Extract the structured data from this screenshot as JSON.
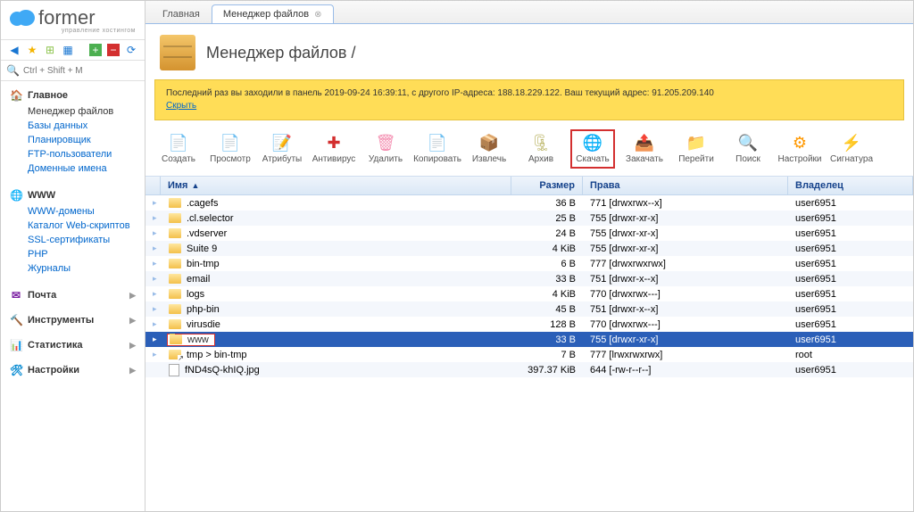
{
  "brand": {
    "name": "former",
    "tagline": "управление хостингом"
  },
  "search": {
    "placeholder": "Ctrl + Shift + M"
  },
  "sidebar": {
    "sections": [
      {
        "title": "Главное",
        "icon": "🏠",
        "icon_color": "#f4b400",
        "expanded": true,
        "items": [
          "Менеджер файлов",
          "Базы данных",
          "Планировщик",
          "FTP-пользователи",
          "Доменные имена"
        ],
        "current": 0
      },
      {
        "title": "WWW",
        "icon": "🌐",
        "icon_color": "#1976d2",
        "expanded": true,
        "items": [
          "WWW-домены",
          "Каталог Web-скриптов",
          "SSL-сертификаты",
          "PHP",
          "Журналы"
        ],
        "current": -1
      },
      {
        "title": "Почта",
        "icon": "✉",
        "icon_color": "#7b1fa2",
        "expanded": false
      },
      {
        "title": "Инструменты",
        "icon": "🔨",
        "icon_color": "#d32f2f",
        "expanded": false
      },
      {
        "title": "Статистика",
        "icon": "📊",
        "icon_color": "#0288d1",
        "expanded": false
      },
      {
        "title": "Настройки",
        "icon": "🛠",
        "icon_color": "#0288d1",
        "expanded": false
      }
    ]
  },
  "tabs": [
    {
      "label": "Главная",
      "active": false,
      "closable": false
    },
    {
      "label": "Менеджер файлов",
      "active": true,
      "closable": true
    }
  ],
  "page": {
    "title": "Менеджер файлов /"
  },
  "notice": {
    "text_prefix": "Последний раз вы заходили в панель 2019-09-24 16:39:11, с другого IP-адреса: 188.18.229.122. Ваш текущий адрес: 91.205.209.140",
    "hide": "Скрыть"
  },
  "toolbar": [
    {
      "id": "create",
      "label": "Создать",
      "icon": "📄",
      "color": "#4caf50"
    },
    {
      "id": "view",
      "label": "Просмотр",
      "icon": "📄",
      "color": "#90caf9"
    },
    {
      "id": "attrs",
      "label": "Атрибуты",
      "icon": "📝",
      "color": "#ffb300"
    },
    {
      "id": "antivirus",
      "label": "Антивирус",
      "icon": "✚",
      "color": "#d32f2f"
    },
    {
      "id": "delete",
      "label": "Удалить",
      "icon": "🗑",
      "color": "#f48fb1"
    },
    {
      "id": "copy",
      "label": "Копировать",
      "icon": "📄",
      "color": "#90caf9"
    },
    {
      "id": "extract",
      "label": "Извлечь",
      "icon": "📦",
      "color": "#bdb76b"
    },
    {
      "id": "archive",
      "label": "Архив",
      "icon": "🗜",
      "color": "#bdb76b"
    },
    {
      "id": "download",
      "label": "Скачать",
      "icon": "🌐",
      "color": "#1976d2",
      "highlighted": true
    },
    {
      "id": "upload",
      "label": "Закачать",
      "icon": "📤",
      "color": "#ffb300"
    },
    {
      "id": "goto",
      "label": "Перейти",
      "icon": "📁",
      "color": "#ffb300"
    },
    {
      "id": "search",
      "label": "Поиск",
      "icon": "🔍",
      "color": "#1976d2"
    },
    {
      "id": "settings",
      "label": "Настройки",
      "icon": "⚙",
      "color": "#ff9800"
    },
    {
      "id": "signature",
      "label": "Сигнатура",
      "icon": "⚡",
      "color": "#e91e63"
    }
  ],
  "columns": {
    "name": "Имя",
    "size": "Размер",
    "perms": "Права",
    "owner": "Владелец"
  },
  "rows": [
    {
      "type": "folder",
      "name": ".cagefs",
      "size": "36 B",
      "perms": "771 [drwxrwx--x]",
      "owner": "user6951"
    },
    {
      "type": "folder",
      "name": ".cl.selector",
      "size": "25 B",
      "perms": "755 [drwxr-xr-x]",
      "owner": "user6951"
    },
    {
      "type": "folder",
      "name": ".vdserver",
      "size": "24 B",
      "perms": "755 [drwxr-xr-x]",
      "owner": "user6951"
    },
    {
      "type": "folder",
      "name": "Suite 9",
      "size": "4 KiB",
      "perms": "755 [drwxr-xr-x]",
      "owner": "user6951"
    },
    {
      "type": "folder",
      "name": "bin-tmp",
      "size": "6 B",
      "perms": "777 [drwxrwxrwx]",
      "owner": "user6951"
    },
    {
      "type": "folder",
      "name": "email",
      "size": "33 B",
      "perms": "751 [drwxr-x--x]",
      "owner": "user6951"
    },
    {
      "type": "folder",
      "name": "logs",
      "size": "4 KiB",
      "perms": "770 [drwxrwx---]",
      "owner": "user6951"
    },
    {
      "type": "folder",
      "name": "php-bin",
      "size": "45 B",
      "perms": "751 [drwxr-x--x]",
      "owner": "user6951"
    },
    {
      "type": "folder",
      "name": "virusdie",
      "size": "128 B",
      "perms": "770 [drwxrwx---]",
      "owner": "user6951"
    },
    {
      "type": "folder",
      "name": "www",
      "size": "33 B",
      "perms": "755 [drwxr-xr-x]",
      "owner": "user6951",
      "selected": true,
      "highlight_red": true
    },
    {
      "type": "link",
      "name": "tmp > bin-tmp",
      "size": "7 B",
      "perms": "777 [lrwxrwxrwx]",
      "owner": "root"
    },
    {
      "type": "file",
      "name": "fND4sQ-khIQ.jpg",
      "size": "397.37 KiB",
      "perms": "644 [-rw-r--r--]",
      "owner": "user6951"
    }
  ]
}
